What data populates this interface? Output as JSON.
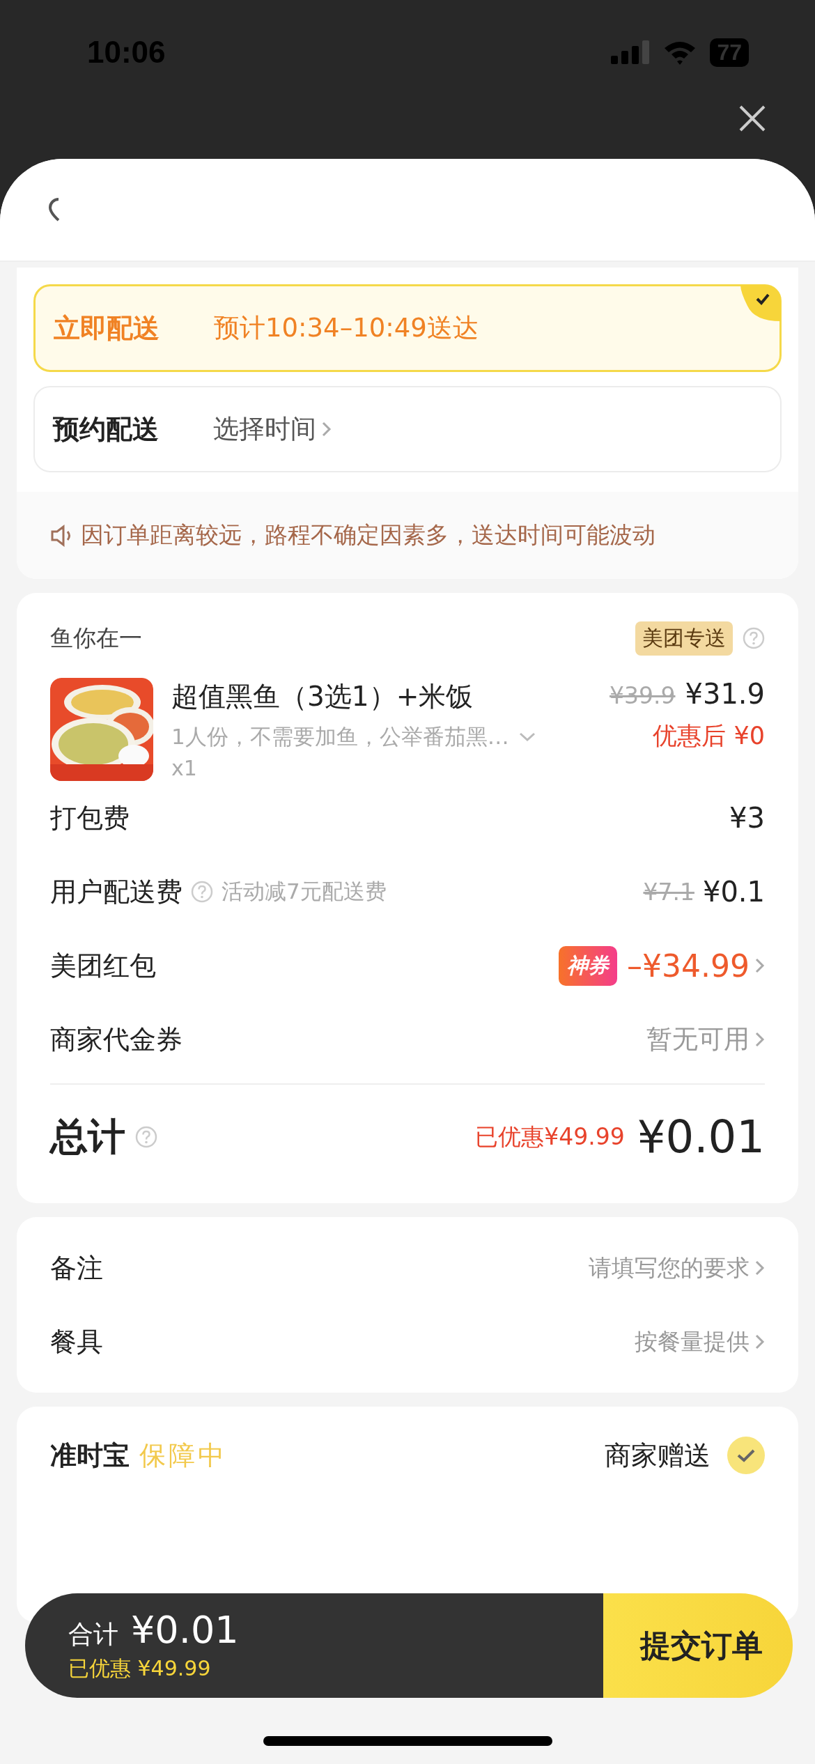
{
  "status_bar": {
    "time": "10:06",
    "battery": "77"
  },
  "delivery": {
    "options": [
      {
        "label": "立即配送",
        "detail": "预计10:34–10:49送达",
        "selected": true,
        "kind": "now"
      },
      {
        "label": "预约配送",
        "detail": "选择时间",
        "selected": false,
        "kind": "schedule"
      }
    ],
    "notice": "因订单距离较远，路程不确定因素多，送达时间可能波动"
  },
  "order": {
    "store": "鱼你在一",
    "badge": "美团专送",
    "item": {
      "name": "超值黑鱼（3选1）+米饭",
      "spec": "1人份，不需要加鱼，公举番茄黑…",
      "qty": "x1",
      "original_price": "¥39.9",
      "price": "¥31.9",
      "discounted": "优惠后 ¥0",
      "kind": "picture"
    },
    "fees": [
      {
        "kind": "plain",
        "label": "打包费",
        "value": "¥3"
      },
      {
        "kind": "delivery",
        "label": "用户配送费",
        "hint": "活动减7元配送费",
        "original": "¥7.1",
        "value": "¥0.1"
      },
      {
        "kind": "coupon",
        "label": "美团红包",
        "tag": "神券",
        "value": "–¥34.99"
      },
      {
        "kind": "voucher",
        "label": "商家代金券",
        "value": "暂无可用"
      }
    ],
    "total": {
      "label": "总计",
      "saved": "已优惠¥49.99",
      "amount": "¥0.01"
    }
  },
  "extras": [
    {
      "label": "备注",
      "value": "请填写您的要求"
    },
    {
      "label": "餐具",
      "value": "按餐量提供"
    }
  ],
  "guarantee": {
    "title": "准时宝",
    "stamp": "保障中",
    "option": "商家赠送",
    "checked": true
  },
  "footer": {
    "label": "合计",
    "amount": "¥0.01",
    "saved": "已优惠 ¥49.99",
    "button": "提交订单"
  }
}
